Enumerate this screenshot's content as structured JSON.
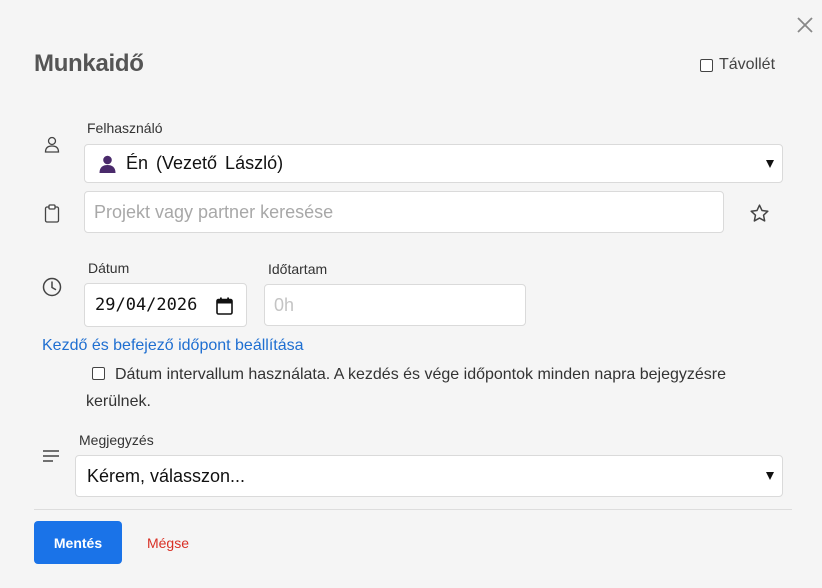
{
  "dialog": {
    "title": "Munkaidő",
    "absence_label": "Távollét"
  },
  "user": {
    "label": "Felhasználó",
    "selected": "Én (Vezető László)"
  },
  "project": {
    "placeholder": "Projekt vagy partner keresése"
  },
  "date": {
    "label": "Dátum",
    "value": "29/04/2026"
  },
  "duration": {
    "label": "Időtartam",
    "placeholder": "0h"
  },
  "time_range_link": "Kezdő és befejező időpont beállítása",
  "interval": {
    "label": "Dátum intervallum használata. A kezdés és vége időpontok minden napra bejegyzésre kerülnek."
  },
  "note": {
    "label": "Megjegyzés",
    "selected": "Kérem, válasszon..."
  },
  "buttons": {
    "save": "Mentés",
    "cancel": "Mégse"
  },
  "icons": {
    "close": "close-icon",
    "user": "user-icon",
    "avatar": "avatar-icon",
    "project": "clipboard-icon",
    "favorite": "star-icon",
    "time": "clock-icon",
    "calendar": "calendar-icon",
    "note": "lines-icon"
  },
  "colors": {
    "primary": "#1a73e8",
    "link": "#1f6fd1",
    "danger": "#d93025",
    "avatar": "#4a2a6b"
  }
}
